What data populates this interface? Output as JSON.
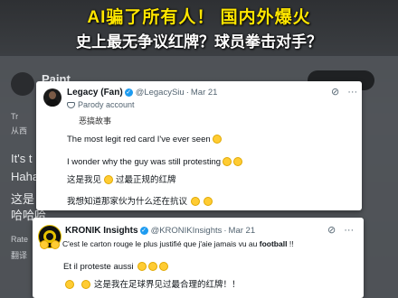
{
  "headline": {
    "line1": "AI骗了所有人！ 国内外爆火",
    "line2": "史上最无争议红牌？球员拳击对手？",
    "line1_color": "#ffe600",
    "line2_color": "#ffffff"
  },
  "background_post": {
    "name_partial": "Paint",
    "line_a": "It's t",
    "line_b": "Haha",
    "line_c": "这是",
    "line_d": "哈哈哈",
    "line_e": "Rate",
    "line_f": "翻译",
    "meta_left": "Tr",
    "meta_left2": "从西"
  },
  "tweets": [
    {
      "name": "Legacy (Fan)",
      "handle": "@LegacySiu",
      "date": "Mar 21",
      "parody_label": "Parody account",
      "translate_label": "恶搞故事",
      "lines": [
        "The most legit red card I've ever seen",
        "I wonder why the guy was still protesting",
        "这是我见",
        "过最正规的红牌",
        "我想知道那家伙为什么还在抗议"
      ]
    },
    {
      "name": "KRONIK Insights",
      "handle": "@KRONIKInsights",
      "date": "Mar 21",
      "lines": [
        "C'est le carton rouge le plus justifié que j'aie jamais vu au",
        "football",
        "!!",
        "Et il proteste aussi",
        "这是我在足球界见过最合理的红牌！！"
      ]
    }
  ],
  "icons": {
    "separator": "·",
    "verified": "✓",
    "more": "···",
    "grok": "⊘"
  }
}
